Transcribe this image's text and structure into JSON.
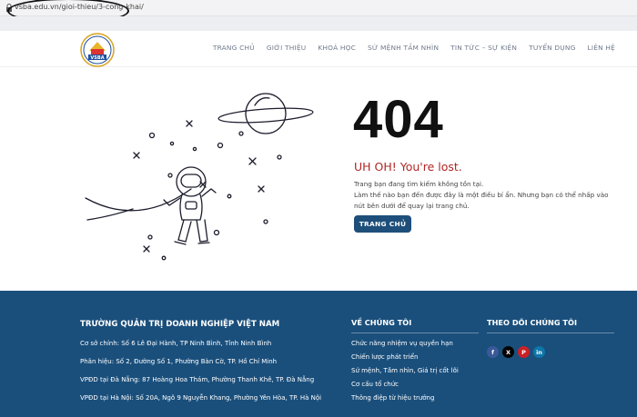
{
  "browser": {
    "url": "vsba.edu.vn/gioi-thieu/3-cong-khai/"
  },
  "header": {
    "logo_text": "VSBA",
    "nav": [
      "TRANG CHỦ",
      "GIỚI THIỆU",
      "KHOÁ HỌC",
      "SỨ MỆNH TẦM NHÌN",
      "TIN TỨC – SỰ KIỆN",
      "TUYỂN DỤNG",
      "LIÊN HỆ"
    ]
  },
  "error": {
    "code": "404",
    "heading": "UH OH! You're lost.",
    "line1": "Trang bạn đang tìm kiếm không tồn tại.",
    "line2": "Làm thế nào bạn đến được đây là một điều bí ẩn. Nhưng bạn có thể nhấp vào nút bên dưới để quay lại trang chủ.",
    "button": "TRANG CHỦ"
  },
  "footer": {
    "org_title": "TRƯỜNG QUẢN TRỊ DOANH NGHIỆP VIỆT NAM",
    "addresses": [
      "Cơ sở chính: Số 6 Lê Đại Hành, TP Ninh Bình, Tỉnh Ninh Bình",
      "Phân hiệu: Số 2, Đường Số 1, Phường Bàn Cờ, TP. Hồ Chí Minh",
      "VPĐD tại Đà Nẵng: 87 Hoàng Hoa Thám, Phường Thanh Khê, TP. Đà Nẵng",
      "VPĐD tại Hà Nội: Số 20A, Ngõ 9 Nguyễn Khang, Phường Yên Hòa, TP. Hà Nội"
    ],
    "about_title": "VỀ CHÚNG TÔI",
    "about_links": [
      "Chức năng nhiệm vụ quyền hạn",
      "Chiến lược phát triển",
      "Sứ mệnh, Tầm nhìn, Giá trị cốt lõi",
      "Cơ cấu tổ chức",
      "Thông điệp từ hiệu trưởng"
    ],
    "follow_title": "THEO DÕI CHÚNG TÔI",
    "socials": [
      {
        "name": "facebook-icon",
        "glyph": "f",
        "color": "#3b5998"
      },
      {
        "name": "x-icon",
        "glyph": "X",
        "color": "#000000"
      },
      {
        "name": "pinterest-icon",
        "glyph": "P",
        "color": "#cb2027"
      },
      {
        "name": "linkedin-icon",
        "glyph": "in",
        "color": "#0e76a8"
      }
    ]
  }
}
